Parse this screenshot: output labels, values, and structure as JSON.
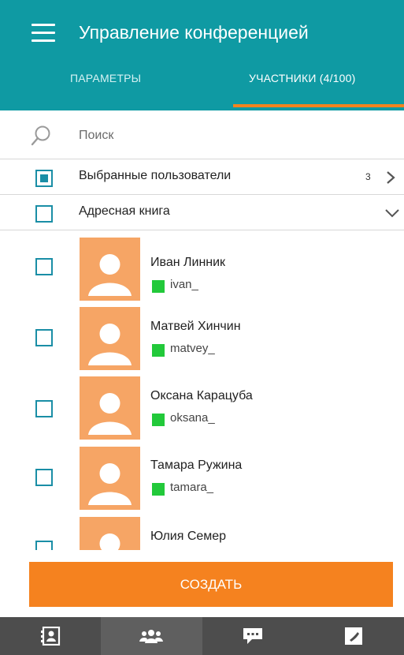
{
  "header": {
    "title": "Управление конференцией",
    "tabs": [
      {
        "label": "ПАРАМЕТРЫ",
        "active": false
      },
      {
        "label": "УЧАСТНИКИ (4/100)",
        "active": true
      }
    ]
  },
  "search": {
    "placeholder": "Поиск",
    "value": ""
  },
  "selected_users": {
    "label": "Выбранные пользователи",
    "count": "3",
    "checked": true
  },
  "address_book": {
    "label": "Адресная книга",
    "checked": false,
    "expanded": true
  },
  "contacts": [
    {
      "name": "Иван Линник",
      "login": "ivan_",
      "status": "online"
    },
    {
      "name": "Матвей Хинчин",
      "login": "matvey_",
      "status": "online"
    },
    {
      "name": "Оксана Карацуба",
      "login": "oksana_",
      "status": "online"
    },
    {
      "name": "Тамара Ружина",
      "login": "tamara_",
      "status": "online"
    },
    {
      "name": "Юлия Семер",
      "login": "",
      "status": "online"
    }
  ],
  "create_button": {
    "label": "СОЗДАТЬ"
  },
  "bottom_nav": {
    "items": [
      {
        "icon": "contact-card-icon",
        "active": false
      },
      {
        "icon": "group-icon",
        "active": true
      },
      {
        "icon": "chat-icon",
        "active": false
      },
      {
        "icon": "phone-icon",
        "active": false
      }
    ]
  },
  "colors": {
    "header": "#0f9aa3",
    "accent": "#f5821f",
    "checkbox": "#1a8ea6",
    "online": "#22c93a",
    "avatar": "#f6a565",
    "bottom_nav": "#4d4d4d"
  }
}
